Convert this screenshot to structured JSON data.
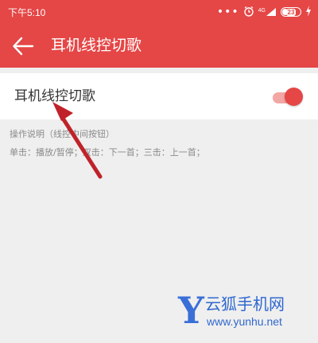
{
  "status_bar": {
    "time": "下午5:10",
    "signal_label": "4G",
    "battery_text": "23",
    "icons": [
      "more-dots-icon",
      "alarm-icon",
      "signal-icon",
      "battery-icon",
      "charging-icon"
    ]
  },
  "app_bar": {
    "back_icon": "arrow-left-icon",
    "title": "耳机线控切歌",
    "background_color": "#e54646"
  },
  "setting": {
    "label": "耳机线控切歌",
    "toggle_on": true,
    "toggle_color": "#e54646"
  },
  "instructions": {
    "title": "操作说明（线控中间按钮）",
    "body": "单击：播放/暂停；双击：下一首；三击：上一首；"
  },
  "watermark": {
    "logo_letter": "Y",
    "name": "云狐手机网",
    "url": "www.yunhu.net"
  }
}
